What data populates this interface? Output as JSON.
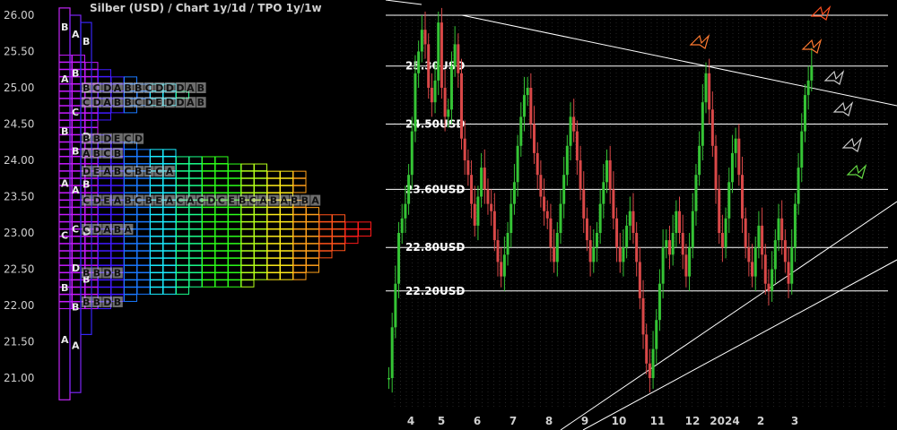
{
  "title": "Silber (USD) /  Chart 1y/1d / TPO 1y/1w",
  "colors": {
    "background": "#000000",
    "candle_up": "#35c435",
    "candle_down": "#d94848",
    "level_line": "#ffffff",
    "tick_text": "#cfcfcf"
  },
  "chart_data": [
    {
      "type": "profile",
      "name": "TPO",
      "y_axis": {
        "ticks": [
          "26.00",
          "25.50",
          "25.00",
          "24.50",
          "24.00",
          "23.50",
          "23.00",
          "22.50",
          "22.00",
          "21.50",
          "21.00"
        ]
      },
      "rows": [
        {
          "price": 25.0,
          "letters": "BCDABBCDDDAB"
        },
        {
          "price": 24.8,
          "letters": "CDABBCDEDDAB"
        },
        {
          "price": 24.3,
          "letters": "BBDECD"
        },
        {
          "price": 24.1,
          "letters": "ABCB"
        },
        {
          "price": 23.85,
          "letters": "DEABCBECA"
        },
        {
          "price": 23.45,
          "letters": "CDEABCBEACACDCEBCABABBA"
        },
        {
          "price": 23.05,
          "letters": "CDABA"
        },
        {
          "price": 22.45,
          "letters": "BBDB"
        },
        {
          "price": 22.05,
          "letters": "BBDB"
        }
      ],
      "columns": [
        {
          "letters": [
            "B",
            "A",
            "B",
            "A",
            "C",
            "B",
            "A"
          ]
        },
        {
          "letters": [
            "A",
            "B",
            "C",
            "B",
            "A",
            "C",
            "D",
            "B",
            "A"
          ]
        },
        {
          "letters": [
            "B",
            "C",
            "D",
            "B",
            "D",
            "B"
          ]
        }
      ]
    },
    {
      "type": "candlestick",
      "name": "Silber (USD)",
      "x": {
        "tick_labels": [
          "4",
          "5",
          "6",
          "7",
          "8",
          "9",
          "10",
          "11",
          "12",
          "2024",
          "2",
          "3"
        ]
      },
      "levels": [
        {
          "label": "25.30USD",
          "value": 25.3
        },
        {
          "label": "24.50USD",
          "value": 24.5
        },
        {
          "label": "23.60USD",
          "value": 23.6
        },
        {
          "label": "22.80USD",
          "value": 22.8
        },
        {
          "label": "22.20USD",
          "value": 22.2
        }
      ],
      "y_range": [
        20.6,
        26.2
      ],
      "series_close": [
        21.0,
        21.7,
        22.3,
        23.0,
        23.2,
        23.4,
        23.8,
        24.4,
        25.2,
        25.5,
        25.8,
        25.6,
        25.0,
        24.8,
        25.1,
        25.9,
        25.0,
        24.6,
        24.7,
        25.3,
        25.6,
        25.2,
        24.3,
        24.0,
        23.8,
        23.4,
        23.1,
        23.5,
        23.9,
        23.6,
        23.4,
        23.3,
        22.9,
        22.6,
        22.4,
        22.7,
        23.0,
        23.4,
        23.7,
        24.2,
        24.6,
        24.9,
        25.0,
        24.5,
        24.1,
        23.8,
        23.5,
        23.3,
        23.2,
        22.8,
        22.6,
        23.0,
        23.4,
        23.8,
        24.2,
        24.6,
        24.4,
        24.0,
        23.6,
        23.2,
        22.9,
        22.6,
        22.8,
        23.0,
        23.4,
        23.7,
        24.0,
        23.6,
        23.2,
        22.8,
        22.6,
        22.8,
        23.1,
        23.3,
        23.0,
        22.6,
        22.1,
        21.6,
        21.2,
        21.0,
        21.4,
        21.8,
        22.3,
        22.8,
        22.9,
        22.7,
        23.0,
        23.3,
        23.0,
        22.7,
        22.4,
        22.8,
        23.3,
        23.8,
        24.2,
        24.8,
        25.2,
        24.7,
        24.2,
        23.6,
        23.0,
        22.8,
        23.2,
        23.7,
        24.1,
        24.3,
        23.8,
        23.2,
        22.8,
        22.6,
        22.4,
        22.8,
        23.1,
        22.7,
        22.3,
        22.2,
        22.5,
        22.9,
        23.2,
        22.9,
        22.6,
        22.3,
        22.8,
        23.4,
        23.9,
        24.4,
        24.9,
        25.1,
        25.3
      ]
    }
  ]
}
